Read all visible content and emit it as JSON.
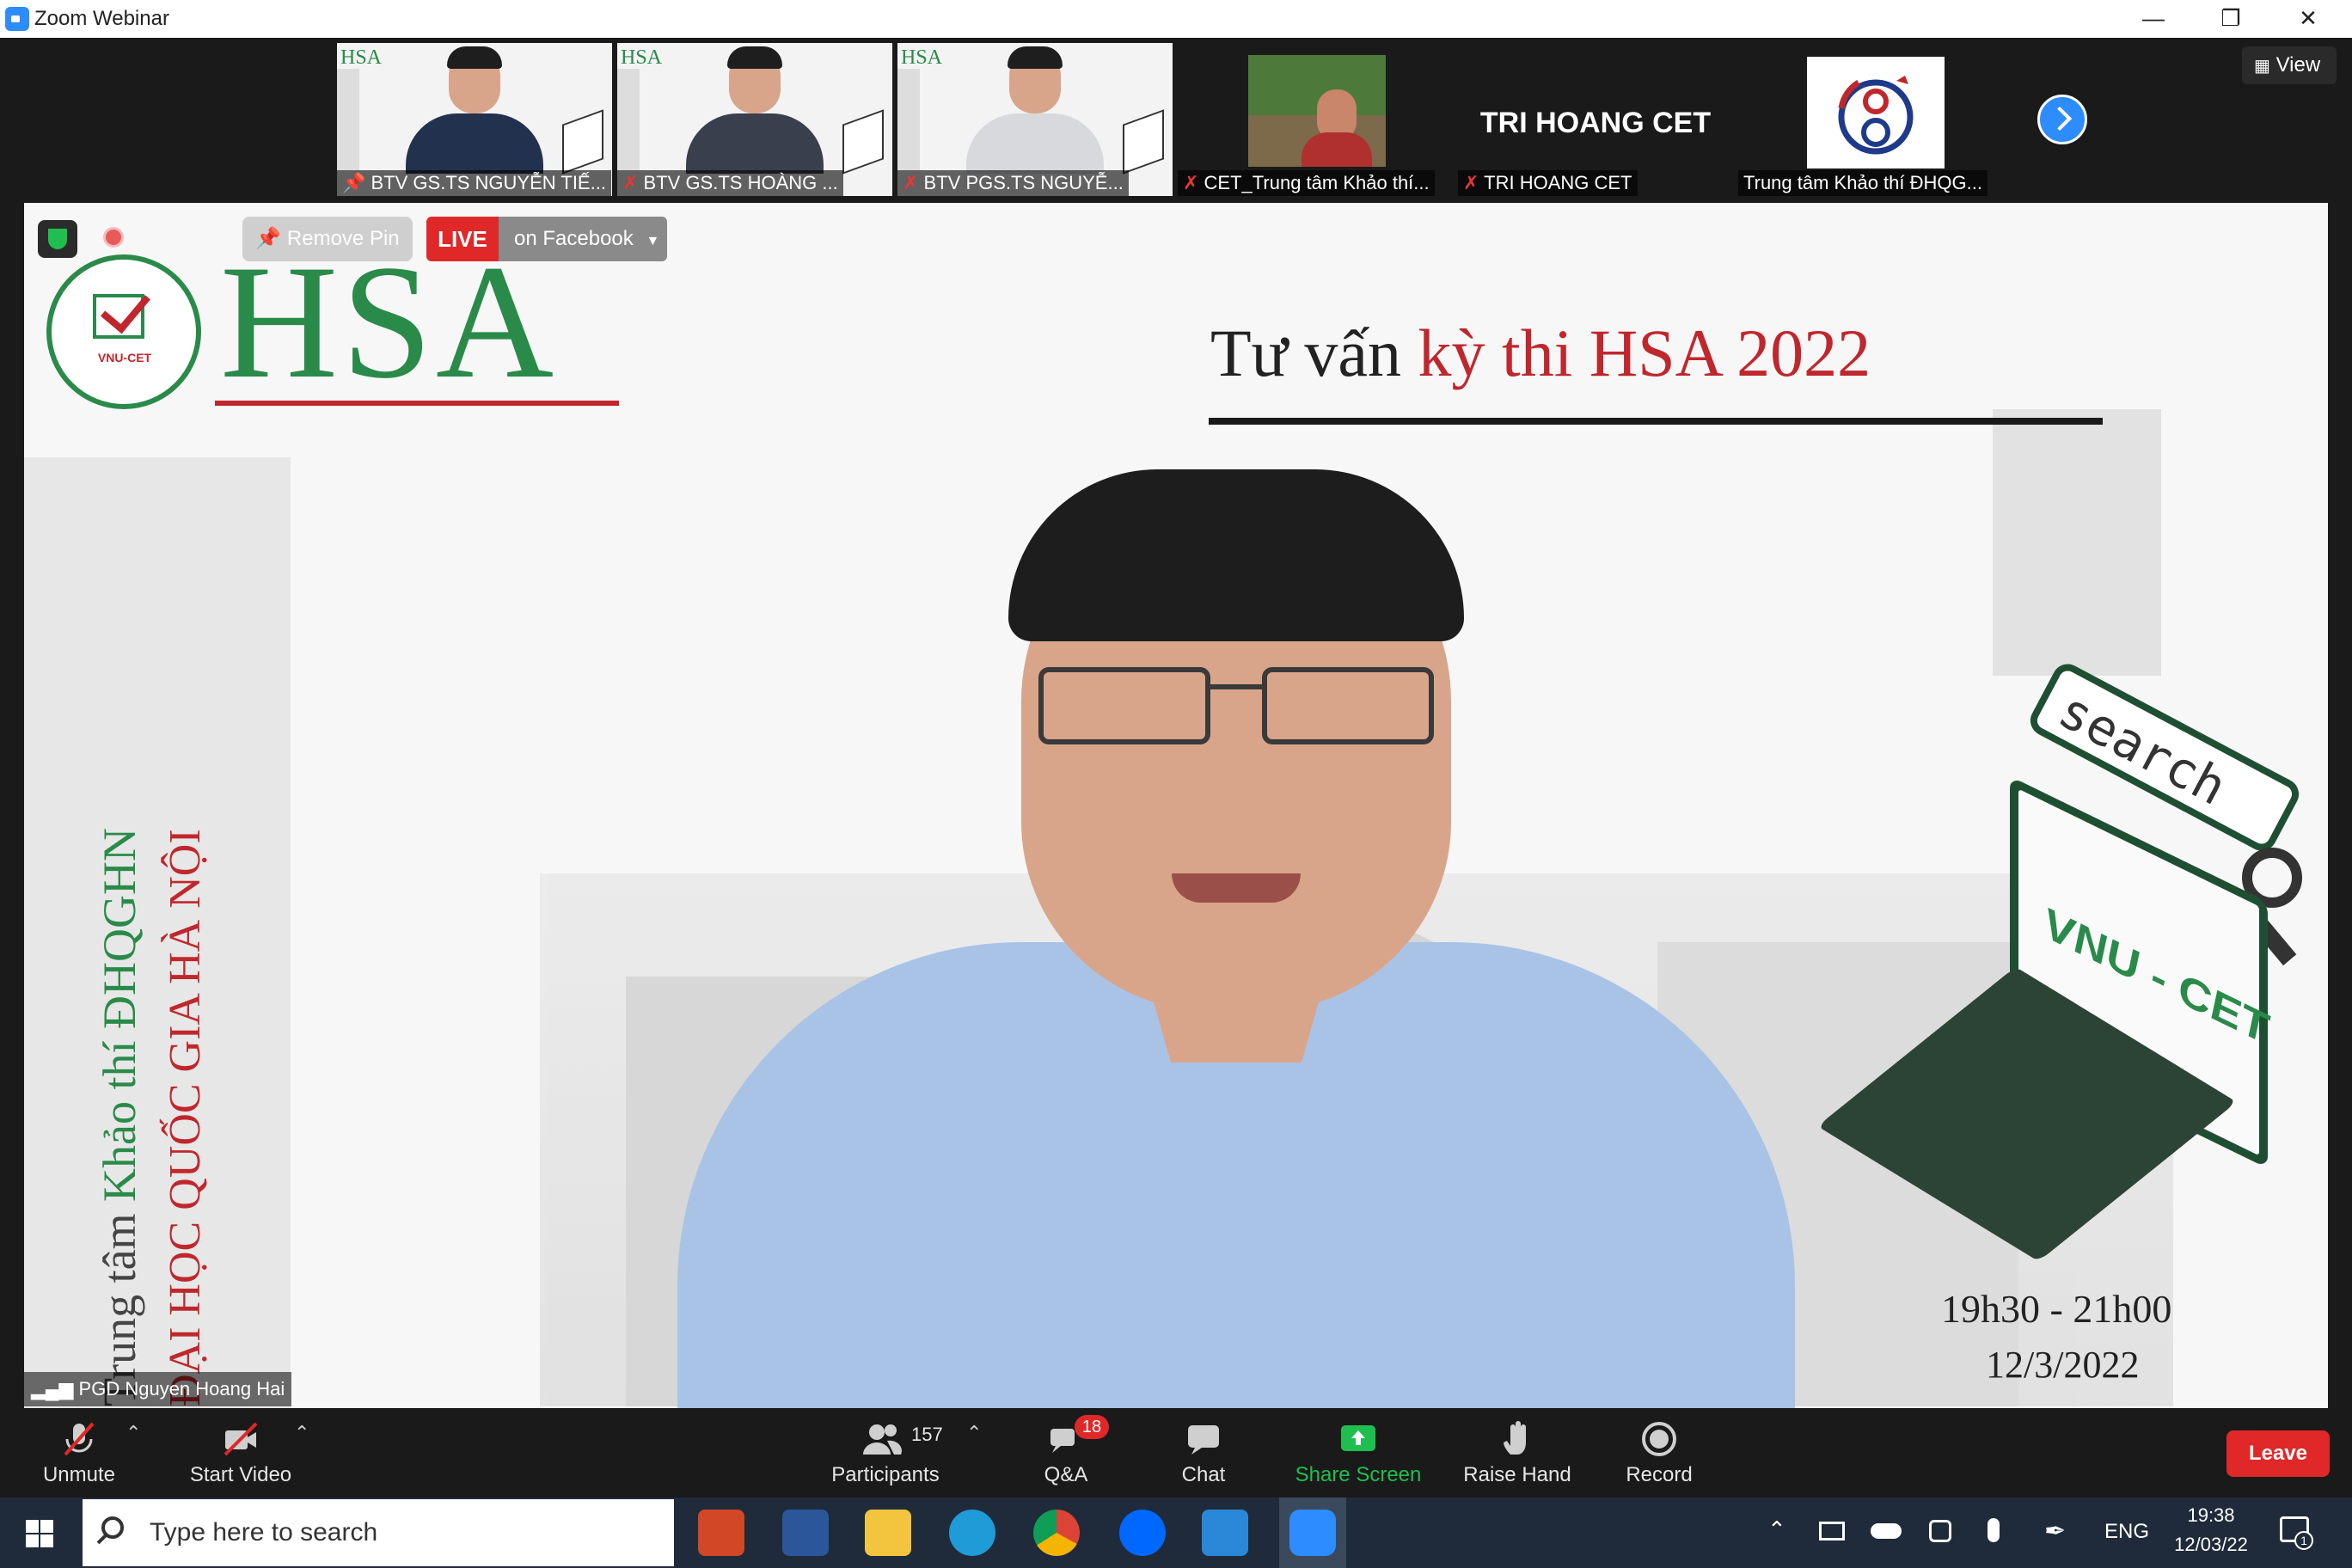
{
  "window": {
    "title": "Zoom Webinar"
  },
  "thumbnails": [
    {
      "label": "BTV GS.TS NGUYỄN TIẾ...",
      "slide_logo": "HSA"
    },
    {
      "label": "BTV GS.TS HOÀNG ...",
      "slide_logo": "HSA"
    },
    {
      "label": "BTV PGS.TS NGUYỄ...",
      "slide_logo": "HSA"
    },
    {
      "label": "CET_Trung tâm Khảo thí..."
    },
    {
      "label": "TRI HOANG CET",
      "name_display": "TRI HOANG CET"
    },
    {
      "label": "Trung tâm Khảo thí ĐHQG..."
    }
  ],
  "view_button": "View",
  "main": {
    "remove_pin": "Remove Pin",
    "live_badge": "LIVE",
    "live_target": "on Facebook",
    "slide": {
      "logo_text": "HSA",
      "logo_badge": "VNU-CET",
      "title_prefix": "Tư vấn ",
      "title_highlight": "kỳ thi HSA 2022",
      "vertical_line1_a": "Trung tâm ",
      "vertical_line1_b": "Khảo thí ĐHQGHN",
      "vertical_line2": "ĐẠI HỌC QUỐC GIA HÀ NỘI",
      "search_word": "search",
      "laptop_screen_text": "VNU - CET",
      "time": "19h30 - 21h00",
      "date": "12/3/2022"
    },
    "speaker_name": "PGD Nguyen Hoang Hai"
  },
  "toolbar": {
    "unmute": "Unmute",
    "start_video": "Start Video",
    "participants_count": "157",
    "participants": "Participants",
    "qa": "Q&A",
    "qa_badge": "18",
    "chat": "Chat",
    "share_screen": "Share Screen",
    "raise_hand": "Raise Hand",
    "record": "Record",
    "leave": "Leave"
  },
  "taskbar": {
    "search_placeholder": "Type here to search",
    "language": "ENG",
    "time": "19:38",
    "date": "12/03/22",
    "notification_count": "1"
  },
  "colors": {
    "accent_red": "#c0272d",
    "accent_green": "#2a8a4a",
    "zoom_blue": "#2d8cff",
    "share_green": "#1fbf4f",
    "leave_red": "#e02828"
  }
}
